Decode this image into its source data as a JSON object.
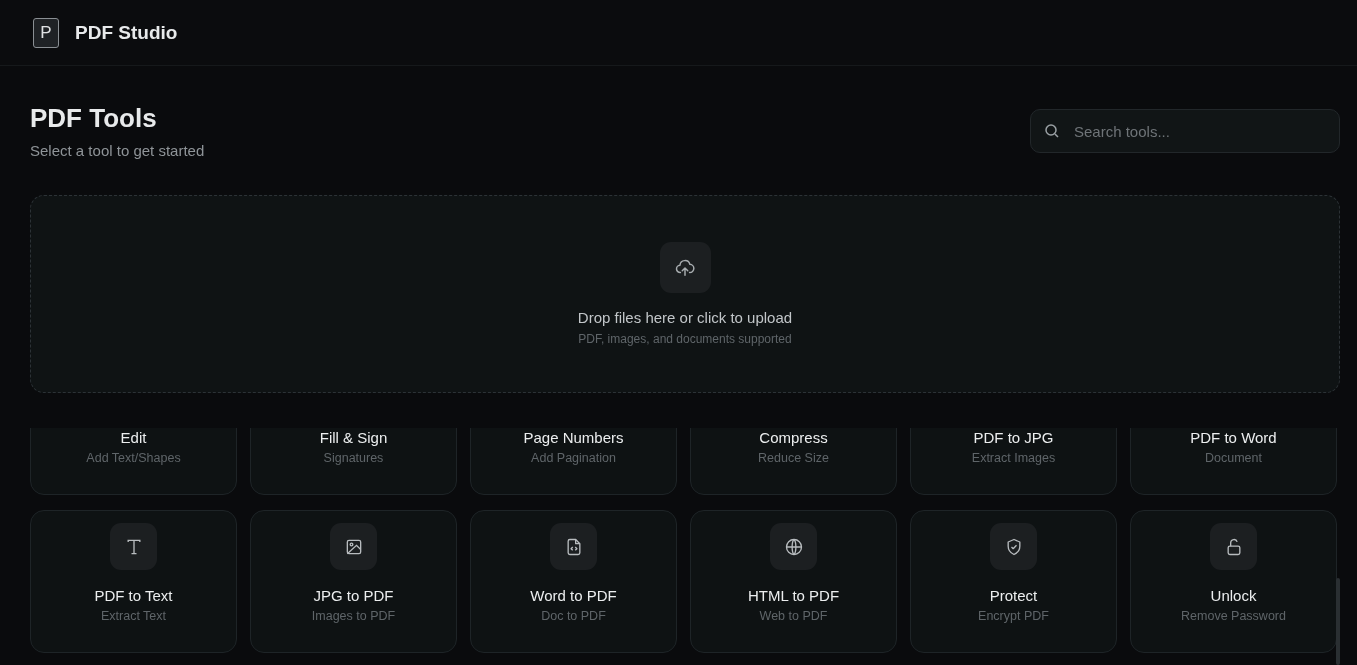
{
  "header": {
    "logo_letter": "P",
    "title": "PDF Studio"
  },
  "page": {
    "title": "PDF Tools",
    "subtitle": "Select a tool to get started"
  },
  "search": {
    "placeholder": "Search tools..."
  },
  "upload": {
    "title": "Drop files here or click to upload",
    "hint": "PDF, images, and documents supported"
  },
  "tools": [
    {
      "name": "Edit",
      "desc": "Add Text/Shapes"
    },
    {
      "name": "Fill & Sign",
      "desc": "Signatures"
    },
    {
      "name": "Page Numbers",
      "desc": "Add Pagination"
    },
    {
      "name": "Compress",
      "desc": "Reduce Size"
    },
    {
      "name": "PDF to JPG",
      "desc": "Extract Images"
    },
    {
      "name": "PDF to Word",
      "desc": "Document"
    },
    {
      "name": "PDF to Text",
      "desc": "Extract Text",
      "kind": "text"
    },
    {
      "name": "JPG to PDF",
      "desc": "Images to PDF",
      "kind": "image"
    },
    {
      "name": "Word to PDF",
      "desc": "Doc to PDF",
      "kind": "code"
    },
    {
      "name": "HTML to PDF",
      "desc": "Web to PDF",
      "kind": "web"
    },
    {
      "name": "Protect",
      "desc": "Encrypt PDF",
      "kind": "protect"
    },
    {
      "name": "Unlock",
      "desc": "Remove Password",
      "kind": "unlock"
    }
  ]
}
